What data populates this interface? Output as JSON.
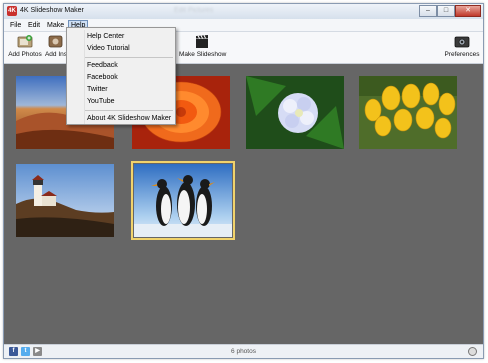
{
  "window": {
    "title": "4K Slideshow Maker",
    "title_blur": "Edit Pictures",
    "icon": "app-icon",
    "controls": [
      "minimize-icon",
      "maximize-icon",
      "close-icon"
    ]
  },
  "menubar": {
    "items": [
      {
        "label": "File"
      },
      {
        "label": "Edit"
      },
      {
        "label": "Make"
      },
      {
        "label": "Help"
      }
    ]
  },
  "help_menu": {
    "group1": [
      {
        "label": "Help Center"
      },
      {
        "label": "Video Tutorial"
      }
    ],
    "group2": [
      {
        "label": "Feedback"
      },
      {
        "label": "Facebook"
      },
      {
        "label": "Twitter"
      },
      {
        "label": "YouTube"
      }
    ],
    "group3": [
      {
        "label": "About 4K Slideshow Maker"
      }
    ]
  },
  "toolbar": {
    "add_photos": "Add Photos",
    "add_instagram": "Add Ins",
    "make_slideshow": "Make Slideshow",
    "preferences": "Preferences"
  },
  "photos": [
    {
      "subject": "desert sand dunes"
    },
    {
      "subject": "orange flower"
    },
    {
      "subject": "white hydrangea"
    },
    {
      "subject": "yellow tulips"
    },
    {
      "subject": "lighthouse"
    },
    {
      "subject": "penguins",
      "selected": true
    }
  ],
  "status": {
    "count_text": "6 photos"
  },
  "colors": {
    "canvas": "#666666",
    "selection": "#f1d36b",
    "facebook": "#3b5998",
    "twitter": "#55acee"
  }
}
